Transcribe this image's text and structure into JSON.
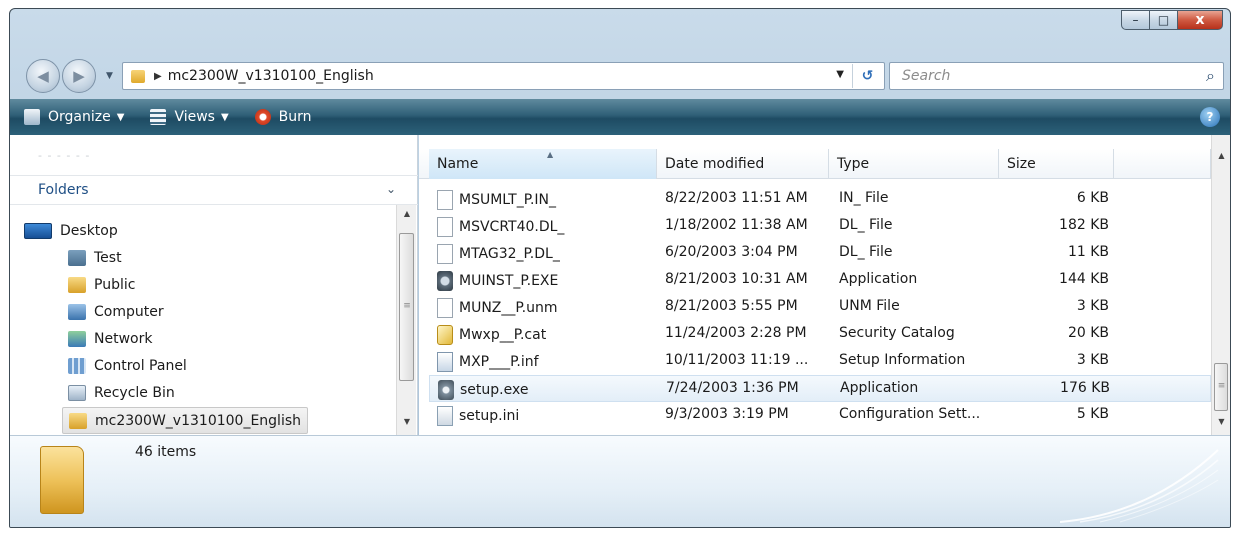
{
  "window": {
    "caption": {
      "minimize": "–",
      "maximize": "□",
      "close": "x"
    }
  },
  "nav": {
    "back_glyph": "◀",
    "forward_glyph": "▶",
    "dropdown_glyph": "▼"
  },
  "address": {
    "separator": "▶",
    "path": "mc2300W_v1310100_English",
    "dropdown_glyph": "▼",
    "refresh_glyph": "↺"
  },
  "search": {
    "placeholder": "Search",
    "icon": "search-icon"
  },
  "toolbar": {
    "organize_label": "Organize",
    "views_label": "Views",
    "burn_label": "Burn",
    "caret": "▼",
    "help_glyph": "?"
  },
  "navpane": {
    "folders_label": "Folders",
    "collapse_glyph": "⌄",
    "tree": [
      {
        "label": "Desktop",
        "icon": "desktop-icon"
      },
      {
        "label": "Test",
        "icon": "user-folder-icon"
      },
      {
        "label": "Public",
        "icon": "folder-icon"
      },
      {
        "label": "Computer",
        "icon": "computer-icon"
      },
      {
        "label": "Network",
        "icon": "network-icon"
      },
      {
        "label": "Control Panel",
        "icon": "control-panel-icon"
      },
      {
        "label": "Recycle Bin",
        "icon": "recycle-bin-icon"
      },
      {
        "label": "mc2300W_v1310100_English",
        "icon": "folder-icon",
        "selected": true
      }
    ]
  },
  "filelist": {
    "columns": {
      "name": "Name",
      "date": "Date modified",
      "type": "Type",
      "size": "Size"
    },
    "sort_caret": "▲",
    "rows": [
      {
        "name": "MSUMLT_P.IN_",
        "date": "8/22/2003 11:51 AM",
        "type": "IN_ File",
        "size": "6 KB",
        "icon": "file-icon"
      },
      {
        "name": "MSVCRT40.DL_",
        "date": "1/18/2002 11:38 AM",
        "type": "DL_ File",
        "size": "182 KB",
        "icon": "file-icon"
      },
      {
        "name": "MTAG32_P.DL_",
        "date": "6/20/2003 3:04 PM",
        "type": "DL_ File",
        "size": "11 KB",
        "icon": "file-icon"
      },
      {
        "name": "MUINST_P.EXE",
        "date": "8/21/2003 10:31 AM",
        "type": "Application",
        "size": "144 KB",
        "icon": "application-icon"
      },
      {
        "name": "MUNZ__P.unm",
        "date": "8/21/2003 5:55 PM",
        "type": "UNM File",
        "size": "3 KB",
        "icon": "file-icon"
      },
      {
        "name": "Mwxp__P.cat",
        "date": "11/24/2003 2:28 PM",
        "type": "Security Catalog",
        "size": "20 KB",
        "icon": "security-catalog-icon"
      },
      {
        "name": "MXP___P.inf",
        "date": "10/11/2003 11:19 ...",
        "type": "Setup Information",
        "size": "3 KB",
        "icon": "setup-information-icon"
      },
      {
        "name": "setup.exe",
        "date": "7/24/2003 1:36 PM",
        "type": "Application",
        "size": "176 KB",
        "icon": "setup-exe-icon",
        "hot": true
      },
      {
        "name": "setup.ini",
        "date": "9/3/2003 3:19 PM",
        "type": "Configuration Sett...",
        "size": "5 KB",
        "icon": "config-settings-icon"
      }
    ]
  },
  "details": {
    "items_count": "46 items"
  },
  "scroll": {
    "up": "▲",
    "down": "▼",
    "grip": "≡"
  }
}
